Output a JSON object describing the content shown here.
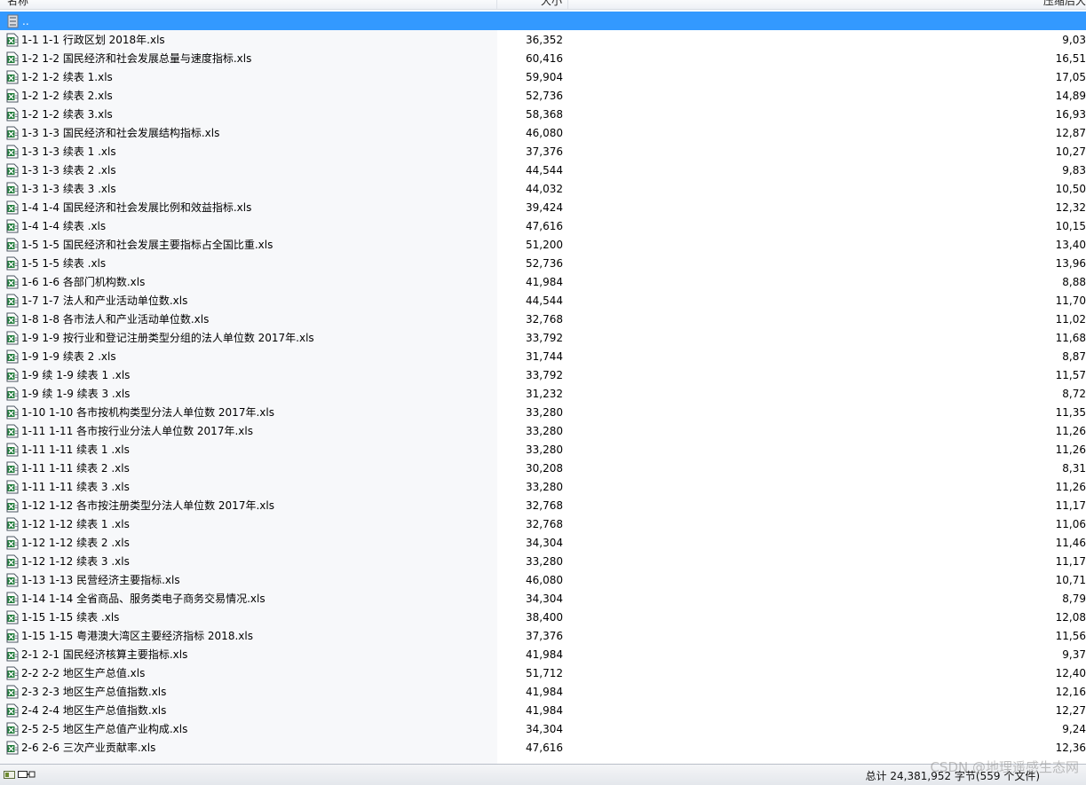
{
  "header": {
    "name_label": "名称",
    "size_label": "大小",
    "packed_label": "压缩后大小"
  },
  "parent_row": {
    "label": ".."
  },
  "files": [
    {
      "name": "1-1    1-1  行政区划 2018年.xls",
      "size": "36,352",
      "packed": "9,03"
    },
    {
      "name": "1-2    1-2  国民经济和社会发展总量与速度指标.xls",
      "size": "60,416",
      "packed": "16,51"
    },
    {
      "name": "1-2    1-2  续表 1.xls",
      "size": "59,904",
      "packed": "17,05"
    },
    {
      "name": "1-2    1-2  续表 2.xls",
      "size": "52,736",
      "packed": "14,89"
    },
    {
      "name": "1-2    1-2  续表 3.xls",
      "size": "58,368",
      "packed": "16,93"
    },
    {
      "name": "1-3    1-3  国民经济和社会发展结构指标.xls",
      "size": "46,080",
      "packed": "12,87"
    },
    {
      "name": "1-3    1-3  续表 1  .xls",
      "size": "37,376",
      "packed": "10,27"
    },
    {
      "name": "1-3    1-3  续表 2  .xls",
      "size": "44,544",
      "packed": "9,83"
    },
    {
      "name": "1-3    1-3  续表 3  .xls",
      "size": "44,032",
      "packed": "10,50"
    },
    {
      "name": "1-4    1-4  国民经济和社会发展比例和效益指标.xls",
      "size": "39,424",
      "packed": "12,32"
    },
    {
      "name": "1-4    1-4  续表  .xls",
      "size": "47,616",
      "packed": "10,15"
    },
    {
      "name": "1-5    1-5  国民经济和社会发展主要指标占全国比重.xls",
      "size": "51,200",
      "packed": "13,40"
    },
    {
      "name": "1-5    1-5  续表  .xls",
      "size": "52,736",
      "packed": "13,96"
    },
    {
      "name": "1-6    1-6  各部门机构数.xls",
      "size": "41,984",
      "packed": "8,88"
    },
    {
      "name": "1-7    1-7  法人和产业活动单位数.xls",
      "size": "44,544",
      "packed": "11,70"
    },
    {
      "name": "1-8    1-8  各市法人和产业活动单位数.xls",
      "size": "32,768",
      "packed": "11,02"
    },
    {
      "name": "1-9    1-9  按行业和登记注册类型分组的法人单位数 2017年.xls",
      "size": "33,792",
      "packed": "11,68"
    },
    {
      "name": "1-9    1-9  续表 2   .xls",
      "size": "31,744",
      "packed": "8,87"
    },
    {
      "name": "1-9 续  1-9 续表 1  .xls",
      "size": "33,792",
      "packed": "11,57"
    },
    {
      "name": "1-9 续  1-9 续表 3  .xls",
      "size": "31,232",
      "packed": "8,72"
    },
    {
      "name": "1-10   1-10  各市按机构类型分法人单位数 2017年.xls",
      "size": "33,280",
      "packed": "11,35"
    },
    {
      "name": "1-11   1-11  各市按行业分法人单位数 2017年.xls",
      "size": "33,280",
      "packed": "11,26"
    },
    {
      "name": "1-11   1-11  续表 1  .xls",
      "size": "33,280",
      "packed": "11,26"
    },
    {
      "name": "1-11   1-11  续表 2  .xls",
      "size": "30,208",
      "packed": "8,31"
    },
    {
      "name": "1-11   1-11  续表 3  .xls",
      "size": "33,280",
      "packed": "11,26"
    },
    {
      "name": "1-12   1-12  各市按注册类型分法人单位数 2017年.xls",
      "size": "32,768",
      "packed": "11,17"
    },
    {
      "name": "1-12   1-12  续表 1  .xls",
      "size": "32,768",
      "packed": "11,06"
    },
    {
      "name": "1-12   1-12  续表 2  .xls",
      "size": "34,304",
      "packed": "11,46"
    },
    {
      "name": "1-12   1-12  续表 3  .xls",
      "size": "33,280",
      "packed": "11,17"
    },
    {
      "name": "1-13   1-13  民营经济主要指标.xls",
      "size": "46,080",
      "packed": "10,71"
    },
    {
      "name": "1-14   1-14  全省商品、服务类电子商务交易情况.xls",
      "size": "34,304",
      "packed": "8,79"
    },
    {
      "name": "1-15   1-15  续表   .xls",
      "size": "38,400",
      "packed": "12,08"
    },
    {
      "name": "1-15   1-15  粤港澳大湾区主要经济指标 2018.xls",
      "size": "37,376",
      "packed": "11,56"
    },
    {
      "name": "2-1    2-1  国民经济核算主要指标.xls",
      "size": "41,984",
      "packed": "9,37"
    },
    {
      "name": "2-2    2-2  地区生产总值.xls",
      "size": "51,712",
      "packed": "12,40"
    },
    {
      "name": "2-3    2-3  地区生产总值指数.xls",
      "size": "41,984",
      "packed": "12,16"
    },
    {
      "name": "2-4    2-4  地区生产总值指数.xls",
      "size": "41,984",
      "packed": "12,27"
    },
    {
      "name": "2-5    2-5  地区生产总值产业构成.xls",
      "size": "34,304",
      "packed": "9,24"
    },
    {
      "name": "2-6    2-6  三次产业贡献率.xls",
      "size": "47,616",
      "packed": "12,36"
    }
  ],
  "status": {
    "summary": "总计 24,381,952 字节(559 个文件)"
  },
  "watermark": "CSDN @地理遥感生态网",
  "colors": {
    "selection": "#3399ff",
    "excel_icon": "#1f7a3a"
  },
  "icons": {
    "parent": "folder-up-icon",
    "file": "excel-file-icon"
  }
}
